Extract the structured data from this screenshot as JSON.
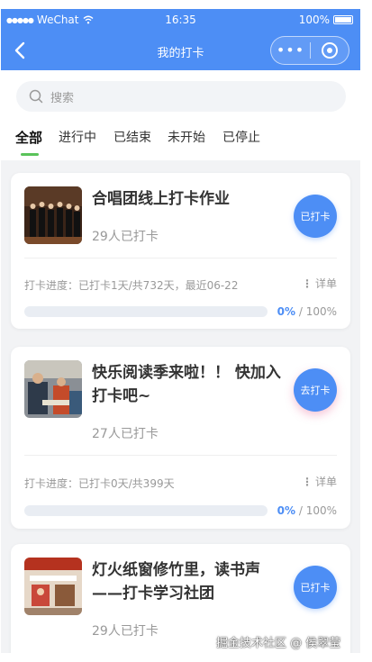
{
  "status_bar": {
    "carrier": "WeChat",
    "time": "16:35",
    "battery": "100%"
  },
  "nav": {
    "title": "我的打卡"
  },
  "search": {
    "placeholder": "搜索"
  },
  "tabs": [
    {
      "label": "全部",
      "active": true
    },
    {
      "label": "进行中"
    },
    {
      "label": "已结束"
    },
    {
      "label": "未开始"
    },
    {
      "label": "已停止"
    }
  ],
  "cards": [
    {
      "title": "合唱团线上打卡作业",
      "count": "29人已打卡",
      "action": "已打卡",
      "progress_text": "打卡进度：已打卡1天/共732天，最近06-22",
      "detail": "详单",
      "percent": "0%",
      "total": "100%",
      "progress": 0
    },
    {
      "title": "快乐阅读季来啦！！ 快加入打卡吧~",
      "count": "27人已打卡",
      "action": "去打卡",
      "progress_text": "打卡进度：已打卡0天/共399天",
      "detail": "详单",
      "percent": "0%",
      "total": "100%",
      "progress": 0
    },
    {
      "title": "灯火纸窗修竹里，读书声——打卡学习社团",
      "count": "29人已打卡",
      "action": "已打卡"
    }
  ],
  "watermark": "掘金技术社区 @ 侯翠莹",
  "colors": {
    "primary": "#4d8ef5",
    "tab_underline": "#5ac35a",
    "background": "#f2f3f5"
  }
}
